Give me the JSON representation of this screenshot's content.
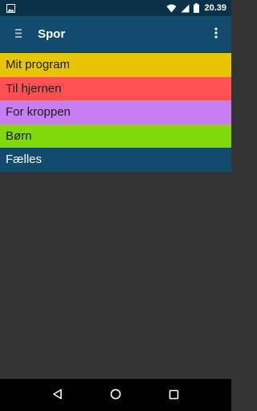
{
  "status_bar": {
    "time": "20.39",
    "icons": [
      "image-notification-icon",
      "wifi-icon",
      "cellular-signal-icon",
      "battery-icon"
    ]
  },
  "toolbar": {
    "title": "Spor",
    "menu_icon": "menu-icon",
    "overflow_icon": "more-vertical-icon"
  },
  "tracks": [
    {
      "label": "Mit program",
      "color": "#e7c500"
    },
    {
      "label": "Til hjernen",
      "color": "#ff5151"
    },
    {
      "label": "For kroppen",
      "color": "#c67ef0"
    },
    {
      "label": "Børn",
      "color": "#7fd90b"
    },
    {
      "label": "Fælles",
      "color": "#114b6d"
    }
  ],
  "colors": {
    "status_bar": "#0b3149",
    "toolbar": "#114b6d",
    "background": "#333333",
    "nav_bar": "#000000"
  },
  "nav_bar": {
    "icons": [
      "back-icon",
      "home-icon",
      "recents-icon"
    ]
  }
}
